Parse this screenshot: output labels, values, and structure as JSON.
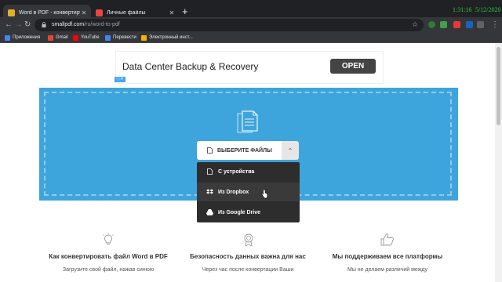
{
  "browser": {
    "tabs": [
      {
        "title": "Word в PDF - конвертируйте D",
        "favicon_color": "#e3b02a"
      },
      {
        "title": "Личные файлы",
        "favicon_color": "#e8473c"
      }
    ],
    "new_tab_symbol": "+",
    "close_symbol": "✕",
    "clock": {
      "time": "1:31:16",
      "date": "5/12/2020"
    },
    "url": {
      "host": "smallpdf.com",
      "path": "/ru/word-to-pdf"
    },
    "bookmarks": [
      {
        "label": "Приложения",
        "icon": "apps-icon",
        "color": "#4285f4"
      },
      {
        "label": "Gmail",
        "icon": "gmail-icon",
        "color": "#ea4335"
      },
      {
        "label": "YouTube",
        "icon": "youtube-icon",
        "color": "#ff0000"
      },
      {
        "label": "Перевести",
        "icon": "translate-icon",
        "color": "#4285f4"
      },
      {
        "label": "Электронный инст...",
        "icon": "bookmark-icon",
        "color": "#f4b400"
      }
    ]
  },
  "ad": {
    "headline": "Data Center Backup & Recovery",
    "button": "OPEN",
    "adchoices": "ⓘ✕"
  },
  "upload": {
    "choose_label": "ВЫБЕРИТЕ ФАЙЛЫ",
    "caret": "⌃",
    "menu": [
      {
        "label": "С устройства",
        "icon": "file-icon"
      },
      {
        "label": "Из Dropbox",
        "icon": "dropbox-icon"
      },
      {
        "label": "Из Google Drive",
        "icon": "google-drive-icon"
      }
    ]
  },
  "features": [
    {
      "title": "Как конвертировать файл Word в PDF",
      "text": "Загрузите свой файл, нажав синюю",
      "icon": "lightbulb-icon"
    },
    {
      "title": "Безопасность данных важна для нас",
      "text": "Через час после конвертации Ваши",
      "icon": "badge-icon"
    },
    {
      "title": "Мы поддерживаем все платформы",
      "text": "Мы не делаем различий между",
      "icon": "thumbs-up-icon"
    }
  ],
  "colors": {
    "accent": "#3ea4dc",
    "menu_bg": "#2d2d2d"
  }
}
